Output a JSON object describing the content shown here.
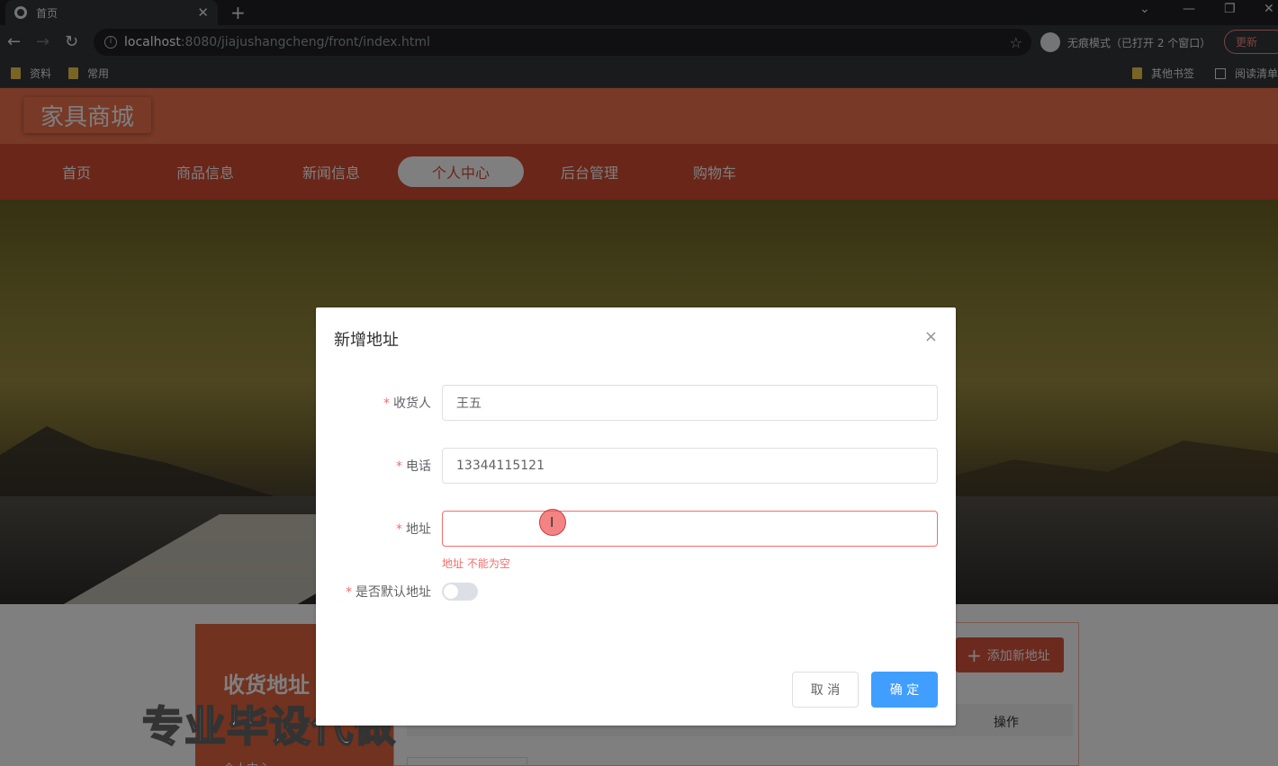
{
  "browser": {
    "tab_title": "首页",
    "tab_close": "✕",
    "new_tab": "+",
    "url_host": "localhost",
    "url_rest": ":8080/jiajushangcheng/front/index.html",
    "incognito_label": "无痕模式（已打开 2 个窗口）",
    "update_label": "更新",
    "bookmarks": [
      "资料",
      "常用"
    ],
    "bookmarks_right": [
      "其他书签",
      "阅读清单"
    ]
  },
  "site": {
    "logo": "家具商城",
    "nav": [
      "首页",
      "商品信息",
      "新闻信息",
      "个人中心",
      "后台管理",
      "购物车"
    ],
    "active_nav": "个人中心",
    "side_title": "收货地址",
    "side_sub": "个人中心",
    "add_button": "添加新地址",
    "table_op_header": "操作"
  },
  "watermark": "专业毕设代做",
  "dialog": {
    "title": "新增地址",
    "close": "×",
    "fields": {
      "receiver_label": "收货人",
      "receiver_value": "王五",
      "phone_label": "电话",
      "phone_value": "13344115121",
      "address_label": "地址",
      "address_value": "",
      "address_error": "地址 不能为空",
      "default_label": "是否默认地址"
    },
    "default_enabled": false,
    "cancel": "取 消",
    "confirm": "确 定"
  }
}
